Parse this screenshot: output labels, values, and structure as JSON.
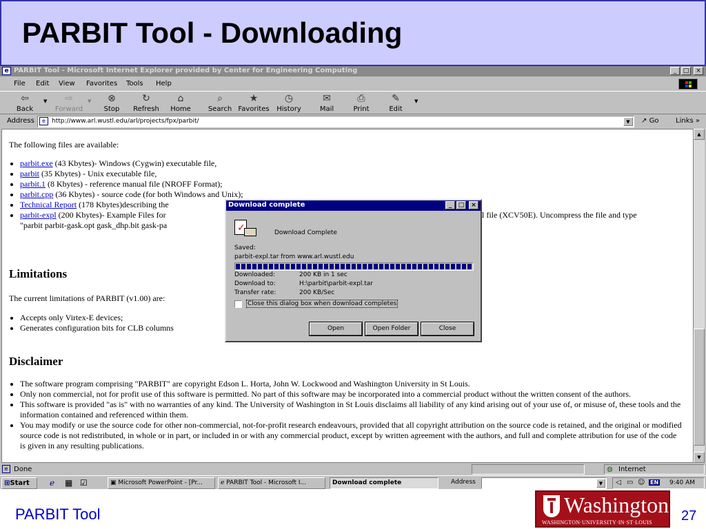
{
  "slide": {
    "title": "PARBIT Tool - Downloading",
    "footer_label": "PARBIT Tool",
    "page_number": "27",
    "logo": {
      "name": "Washington",
      "subtitle": "WASHINGTON·UNIVERSITY·IN·ST·LOUIS"
    }
  },
  "window": {
    "title": "PARBIT Tool - Microsoft Internet Explorer provided by Center for Engineering Computing",
    "controls": {
      "minimize": "_",
      "maximize": "□",
      "close": "×"
    }
  },
  "menu": [
    "File",
    "Edit",
    "View",
    "Favorites",
    "Tools",
    "Help"
  ],
  "toolbar": [
    {
      "label": "Back",
      "icon": "back-arrow-icon"
    },
    {
      "label": "Forward",
      "icon": "forward-arrow-icon"
    },
    {
      "label": "Stop",
      "icon": "stop-icon"
    },
    {
      "label": "Refresh",
      "icon": "refresh-icon"
    },
    {
      "label": "Home",
      "icon": "home-icon"
    },
    {
      "label": "Search",
      "icon": "search-icon"
    },
    {
      "label": "Favorites",
      "icon": "favorites-icon"
    },
    {
      "label": "History",
      "icon": "history-icon"
    },
    {
      "label": "Mail",
      "icon": "mail-icon"
    },
    {
      "label": "Print",
      "icon": "print-icon"
    },
    {
      "label": "Edit",
      "icon": "edit-icon"
    }
  ],
  "addressbar": {
    "label": "Address",
    "url": "http://www.arl.wustl.edu/arl/projects/fpx/parbit/",
    "go": "Go",
    "links": "Links »"
  },
  "page": {
    "intro": "The following files are available:",
    "files": [
      {
        "link": "parbit.exe",
        "text": " (43 Kbytes)- Windows (Cygwin) executable file,"
      },
      {
        "link": "parbit",
        "text": " (35 Kbytes) - Unix executable file,"
      },
      {
        "link": "parbit.1",
        "text": " (8 Kbytes) - reference manual file (NROFF Format);"
      },
      {
        "link": "parbit.cpp",
        "text": " (36 Kbytes) - source code (for both Windows and Unix);"
      },
      {
        "link": "Technical Report",
        "text": " (178 Kbytes)describing the"
      },
      {
        "link": "parbit-expl",
        "text": " (200 Kbytes)- Example Files for"
      }
    ],
    "files_tail_right": "l file (XCV50E). Uncompress the file and type",
    "files_tail_line": "\"parbit parbit-gask.opt gask_dhp.bit gask-pa",
    "limitations_heading": "Limitations",
    "limitations_intro": "The current limitations of PARBIT (v1.00) are:",
    "limitations": [
      "Accepts only Virtex-E devices;",
      "Generates configuration bits for CLB columns"
    ],
    "disclaimer_heading": "Disclaimer",
    "disclaimer": [
      "The software program comprising \"PARBIT\" are copyright Edson L. Horta, John W. Lockwood and Washington University in St Louis.",
      "Only non commercial, not for profit use of this software is permitted. No part of this software may be incorporated into a commercial product without the written consent of the authors.",
      "This software is provided \"as is\" with no warranties of any kind. The University of Washington in St Louis disclaims all liability of any kind arising out of your use of, or misuse of, these tools and the information contained and referenced within them.",
      "You may modify or use the source code for other non-commercial, not-for-profit research endeavours, provided that all copyright attribution on the source code is retained, and the original or modified source code is not redistributed, in whole or in part, or included in or with any commercial product, except by written agreement with the authors, and full and complete attribution for use of the code is given in any resulting publications."
    ]
  },
  "dialog": {
    "title": "Download complete",
    "heading": "Download Complete",
    "saved_label": "Saved:",
    "saved_value": "parbit-expl.tar from www.arl.wustl.edu",
    "progress": 1.0,
    "rows": [
      {
        "label": "Downloaded:",
        "value": "200 KB in 1 sec"
      },
      {
        "label": "Download to:",
        "value": "H:\\parbit\\parbit-expl.tar"
      },
      {
        "label": "Transfer rate:",
        "value": "200 KB/Sec"
      }
    ],
    "checkbox_label": "Close this dialog box when download completes",
    "buttons": [
      "Open",
      "Open Folder",
      "Close"
    ]
  },
  "statusbar": {
    "text": "Done",
    "zone": "Internet"
  },
  "taskbar": {
    "start": "Start",
    "tasks": [
      "Microsoft PowerPoint - [Pr...",
      "PARBIT Tool - Microsoft I...",
      "Download complete"
    ],
    "address_label": "Address",
    "lang": "EN",
    "time": "9:40 AM"
  }
}
